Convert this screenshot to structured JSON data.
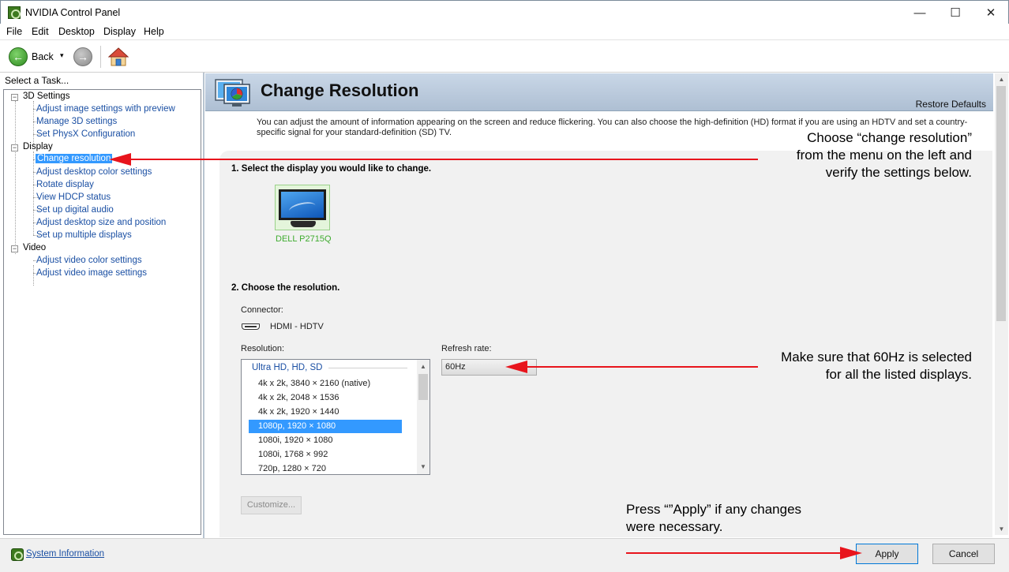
{
  "window": {
    "title": "NVIDIA Control Panel",
    "minimize": "—",
    "maximize": "☐",
    "close": "✕"
  },
  "menu": [
    "File",
    "Edit",
    "Desktop",
    "Display",
    "Help"
  ],
  "toolbar": {
    "back_label": "Back",
    "dropdown": "▾",
    "back_glyph": "←",
    "forward_glyph": "→"
  },
  "sidebar": {
    "heading": "Select a Task...",
    "categories": [
      {
        "label": "3D Settings",
        "toggle": "−",
        "items": [
          "Adjust image settings with preview",
          "Manage 3D settings",
          "Set PhysX Configuration"
        ]
      },
      {
        "label": "Display",
        "toggle": "−",
        "items": [
          "Change resolution",
          "Adjust desktop color settings",
          "Rotate display",
          "View HDCP status",
          "Set up digital audio",
          "Adjust desktop size and position",
          "Set up multiple displays"
        ]
      },
      {
        "label": "Video",
        "toggle": "−",
        "items": [
          "Adjust video color settings",
          "Adjust video image settings"
        ]
      }
    ],
    "selected_item": "Change resolution"
  },
  "page": {
    "title": "Change Resolution",
    "restore_defaults": "Restore Defaults",
    "description": "You can adjust the amount of information appearing on the screen and reduce flickering. You can also choose the high-definition (HD) format if you are using an HDTV and set a country-specific signal for your standard-definition (SD) TV.",
    "step1": "1. Select the display you would like to change.",
    "display_name": "DELL P2715Q",
    "step2": "2. Choose the resolution.",
    "connector_label": "Connector:",
    "connector_value": "HDMI - HDTV",
    "resolution_label": "Resolution:",
    "refresh_label": "Refresh rate:",
    "refresh_value": "60Hz",
    "customize_label": "Customize...",
    "resolution_group": "Ultra HD, HD, SD",
    "resolutions": [
      "4k x 2k, 3840 × 2160 (native)",
      "4k x 2k, 2048 × 1536",
      "4k x 2k, 1920 × 1440",
      "1080p, 1920 × 1080",
      "1080i, 1920 × 1080",
      "1080i, 1768 × 992",
      "720p, 1280 × 720"
    ],
    "selected_resolution": "1080p, 1920 × 1080"
  },
  "footer": {
    "system_info": "System Information",
    "apply": "Apply",
    "cancel": "Cancel"
  },
  "annotations": {
    "a1_line1": "Choose “change resolution”",
    "a1_line2": "from the menu on the left and",
    "a1_line3": "verify the settings below.",
    "a2_line1": "Make sure that 60Hz is selected",
    "a2_line2": "for all the listed displays.",
    "a3_line1": "Press “”Apply” if any changes",
    "a3_line2": "were necessary.",
    "arrow_color": "#e8141c"
  },
  "colors": {
    "link": "#1a4fa3",
    "selection": "#3399ff",
    "display_name": "#3eab2e",
    "banner": "#b9c9dc"
  }
}
